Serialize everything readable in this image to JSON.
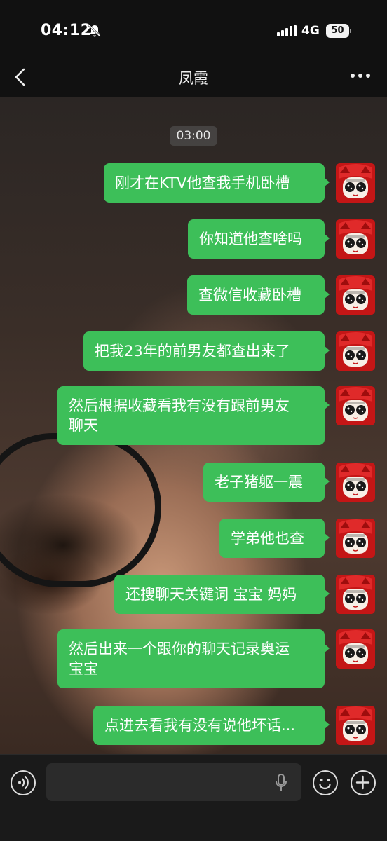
{
  "status_bar": {
    "time": "04:12",
    "network": "4G",
    "battery": "50"
  },
  "nav": {
    "title": "凤霞"
  },
  "chat": {
    "time_stamp": "03:00",
    "messages": [
      {
        "text": "刚才在KTV他查我手机卧槽"
      },
      {
        "text": "你知道他查啥吗"
      },
      {
        "text": "查微信收藏卧槽"
      },
      {
        "text": "把我23年的前男友都查出来了"
      },
      {
        "text": "然后根据收藏看我有没有跟前男友\n聊天"
      },
      {
        "text": "老子猪躯一震"
      },
      {
        "text": "学弟他也查"
      },
      {
        "text": "还搜聊天关键词 宝宝 妈妈"
      },
      {
        "text": "然后出来一个跟你的聊天记录奥运\n宝宝"
      },
      {
        "text": "点进去看我有没有说他坏话..."
      }
    ]
  },
  "input_bar": {
    "value": ""
  },
  "colors": {
    "bubble": "#3dbf59",
    "bar": "#1a1a1a"
  }
}
